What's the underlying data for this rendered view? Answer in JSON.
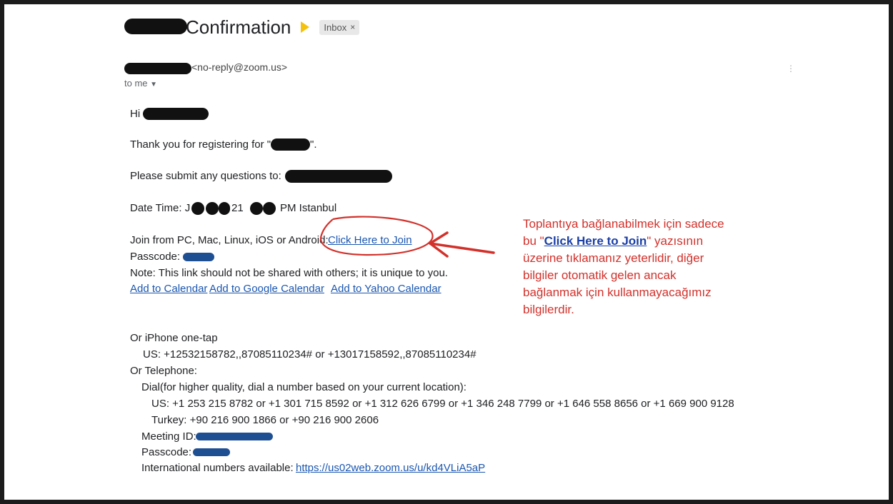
{
  "subject": {
    "title": "Confirmation",
    "chip_label": "Inbox",
    "chip_close": "×"
  },
  "sender": {
    "email": "<no-reply@zoom.us>",
    "to": "to me"
  },
  "body": {
    "greeting": "Hi",
    "thanks_pre": "Thank you for registering for \"",
    "thanks_post": "\".",
    "questions": "Please submit any questions to:",
    "date_a": "Date Time: J",
    "date_b": "21",
    "date_c": "PM Istanbul",
    "join_pre": "Join from PC, Mac, Linux, iOS or Android:",
    "join_link": "Click Here to Join",
    "passcode": "Passcode:",
    "note": "Note: This link should not be shared with others; it is unique to you.",
    "calendar_links": [
      "Add to Calendar",
      "Add to Google Calendar",
      "Add to Yahoo Calendar"
    ],
    "iphone_title": "Or iPhone one-tap",
    "iphone_us": "US: +12532158782,,87085110234# or +13017158592,,87085110234#",
    "telephone_title": "Or Telephone:",
    "dial_note": "Dial(for higher quality, dial a number based on your current location):",
    "dial_us": "US: +1 253 215 8782 or +1 301 715 8592 or +1 312 626 6799 or +1 346 248 7799 or +1 646 558 8656 or +1 669 900 9128",
    "dial_turkey": "Turkey: +90 216 900 1866 or +90 216 900 2606",
    "meeting_id": "Meeting ID:",
    "passcode2": "Passcode:",
    "intl_pre": "International numbers available:",
    "intl_link": "https://us02web.zoom.us/u/kd4VLiA5aP"
  },
  "annotation": {
    "l1": "Toplantıya bağlanabilmek için sadece",
    "l2a": "bu \"",
    "l2b": "Click Here to Join",
    "l2c": "\" yazısının",
    "l3": "üzerine tıklamanız yeterlidir, diğer",
    "l4": "bilgiler otomatik gelen ancak",
    "l5": "bağlanmak için kullanmayacağımız",
    "l6": "bilgilerdir."
  },
  "colors": {
    "annotation": "#d2312b",
    "link": "#1a56b0",
    "label_arrow": "#f4c20d"
  }
}
